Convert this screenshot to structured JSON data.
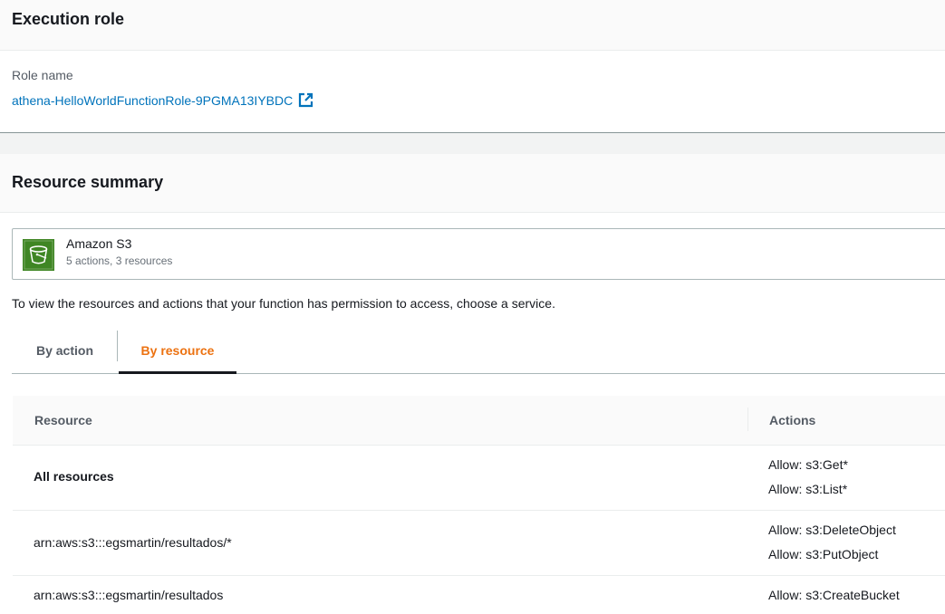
{
  "execution_role": {
    "title": "Execution role",
    "role_name_label": "Role name",
    "role_name": "athena-HelloWorldFunctionRole-9PGMA13IYBDC"
  },
  "resource_summary": {
    "title": "Resource summary",
    "service": {
      "name": "Amazon S3",
      "meta": "5 actions, 3 resources",
      "icon": "s3-bucket-icon",
      "color": "#3f8624"
    },
    "info_text": "To view the resources and actions that your function has permission to access, choose a service.",
    "tabs": [
      {
        "label": "By action",
        "active": false
      },
      {
        "label": "By resource",
        "active": true
      }
    ],
    "table": {
      "columns": [
        "Resource",
        "Actions"
      ],
      "rows": [
        {
          "resource": "All resources",
          "actions": [
            "Allow: s3:Get*",
            "Allow: s3:List*"
          ]
        },
        {
          "resource": "arn:aws:s3:::egsmartin/resultados/*",
          "actions": [
            "Allow: s3:DeleteObject",
            "Allow: s3:PutObject"
          ]
        },
        {
          "resource": "arn:aws:s3:::egsmartin/resultados",
          "actions": [
            "Allow: s3:CreateBucket"
          ]
        }
      ]
    }
  },
  "colors": {
    "link": "#0073bb",
    "active_tab": "#ec7211"
  }
}
